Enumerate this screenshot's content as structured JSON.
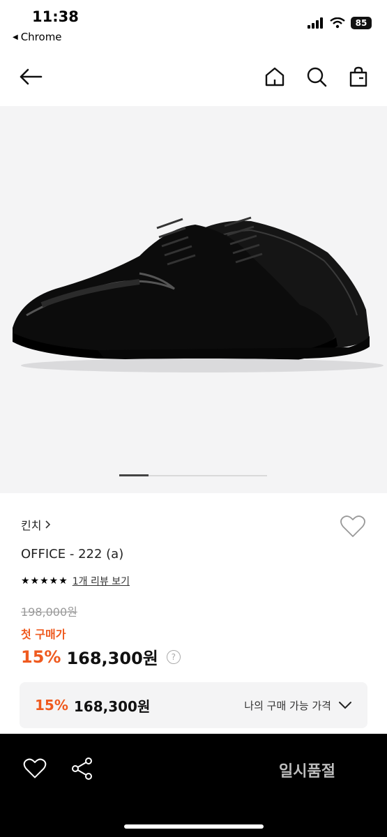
{
  "status": {
    "time": "11:38",
    "back_app": "Chrome",
    "battery": "85"
  },
  "product": {
    "brand": "킨치",
    "title": "OFFICE - 222 (a)",
    "stars": "★★★★★",
    "review_link": "1개 리뷰 보기",
    "original_price": "198,000원",
    "first_purchase_label": "첫 구매가",
    "discount": "15%",
    "sale_price": "168,300원",
    "help_symbol": "?"
  },
  "my_price": {
    "discount": "15%",
    "price": "168,300원",
    "label": "나의 구매 가능 가격"
  },
  "bottom_bar": {
    "action_label": "일시품절"
  },
  "gallery": {
    "current_fraction": 0.2
  },
  "colors": {
    "accent": "#ef5a1f",
    "bottom_bg": "#000000",
    "soldout_text": "#bdbdbd"
  }
}
